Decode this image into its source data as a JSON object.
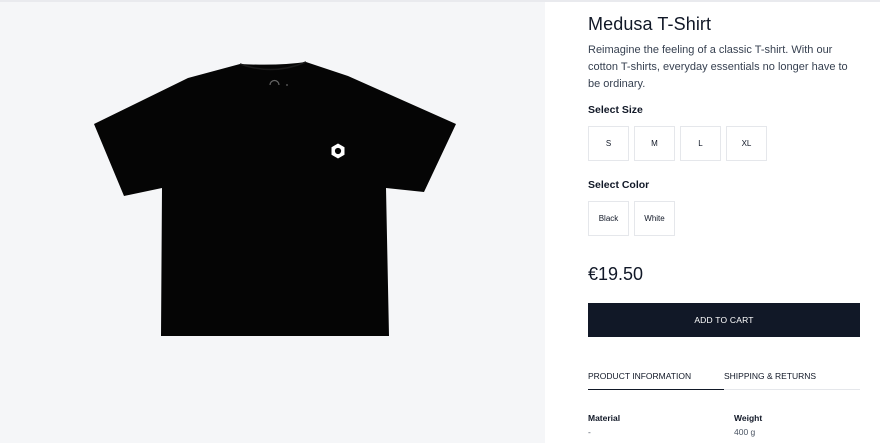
{
  "product": {
    "title": "Medusa T-Shirt",
    "description": "Reimagine the feeling of a classic T-shirt. With our cotton T-shirts, everyday essentials no longer have to be ordinary.",
    "image_alt": "black t-shirt"
  },
  "size": {
    "label": "Select Size",
    "options": [
      "S",
      "M",
      "L",
      "XL"
    ]
  },
  "color": {
    "label": "Select Color",
    "options": [
      "Black",
      "White"
    ]
  },
  "price": "€19.50",
  "cart_button": "ADD TO CART",
  "tabs": [
    "PRODUCT INFORMATION",
    "SHIPPING & RETURNS"
  ],
  "specs": {
    "material_label": "Material",
    "material_value": "-",
    "weight_label": "Weight",
    "weight_value": "400 g"
  },
  "colors": {
    "background": "#f5f6f8",
    "button": "#111827",
    "shirt": "#050505"
  }
}
